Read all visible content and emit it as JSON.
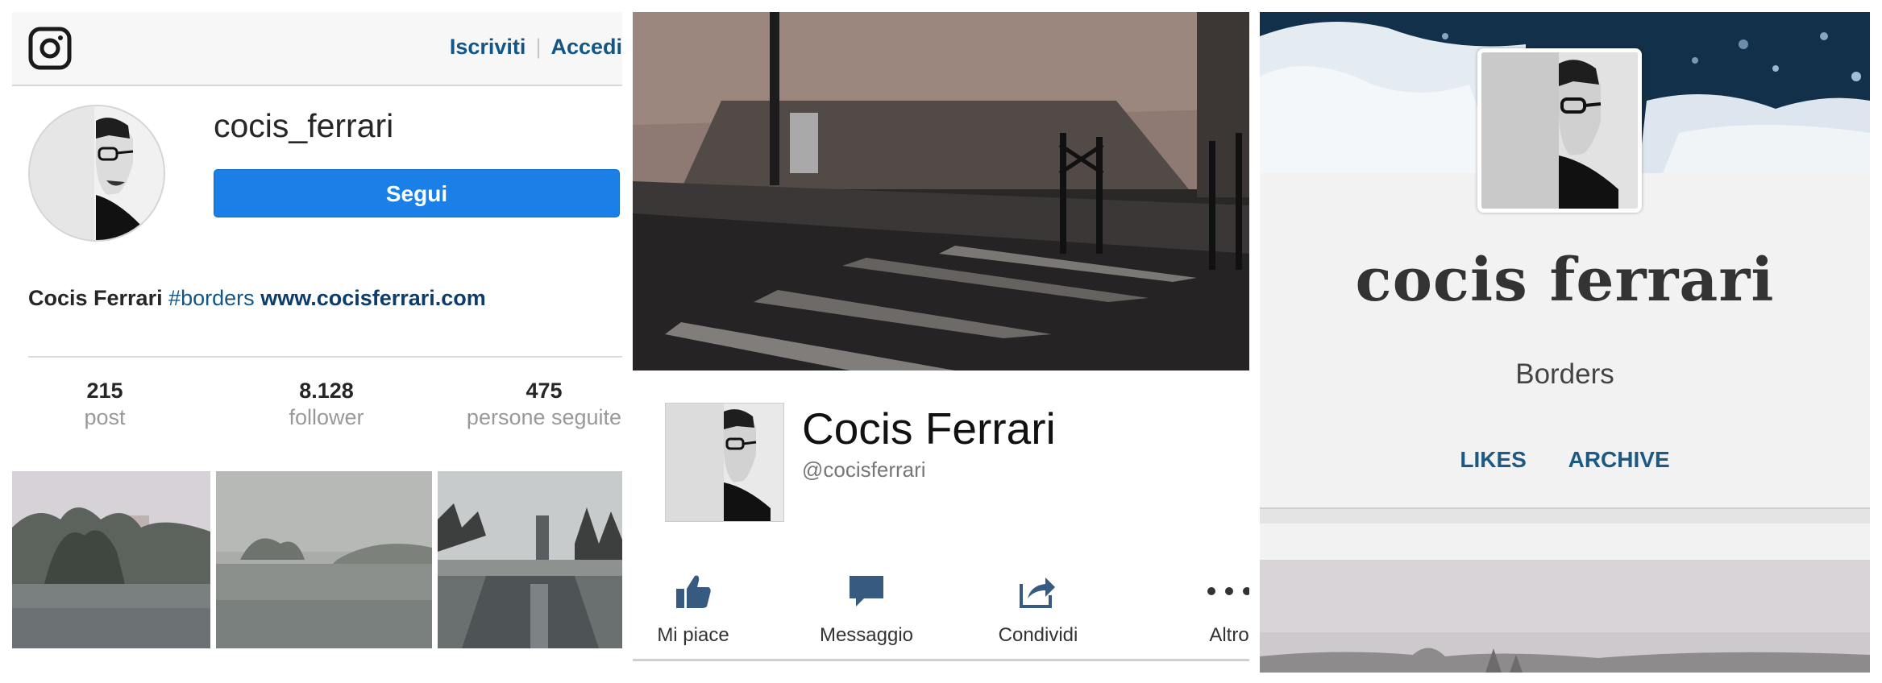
{
  "instagram": {
    "links": {
      "signup": "Iscriviti",
      "separator": "|",
      "login": "Accedi"
    },
    "username": "cocis_ferrari",
    "follow_button": "Segui",
    "bio": {
      "name": "Cocis Ferrari",
      "hashtag": "#borders",
      "website": "www.cocisferrari.com"
    },
    "stats": [
      {
        "value": "215",
        "label": "post"
      },
      {
        "value": "8.128",
        "label": "follower"
      },
      {
        "value": "475",
        "label": "persone seguite"
      }
    ],
    "icons": {
      "logo": "instagram-logo-icon"
    },
    "colors": {
      "link": "#125688",
      "button": "#1a7fe6"
    }
  },
  "facebook": {
    "name": "Cocis Ferrari",
    "handle": "@cocisferrari",
    "actions": [
      {
        "label": "Mi piace",
        "icon": "thumbs-up-icon"
      },
      {
        "label": "Messaggio",
        "icon": "message-icon"
      },
      {
        "label": "Condividi",
        "icon": "share-icon"
      },
      {
        "label": "Altro",
        "icon": "more-icon"
      }
    ]
  },
  "tumblr": {
    "title": "cocis ferrari",
    "description": "Borders",
    "nav": [
      "LIKES",
      "ARCHIVE"
    ],
    "colors": {
      "nav": "#1c5a86"
    }
  }
}
